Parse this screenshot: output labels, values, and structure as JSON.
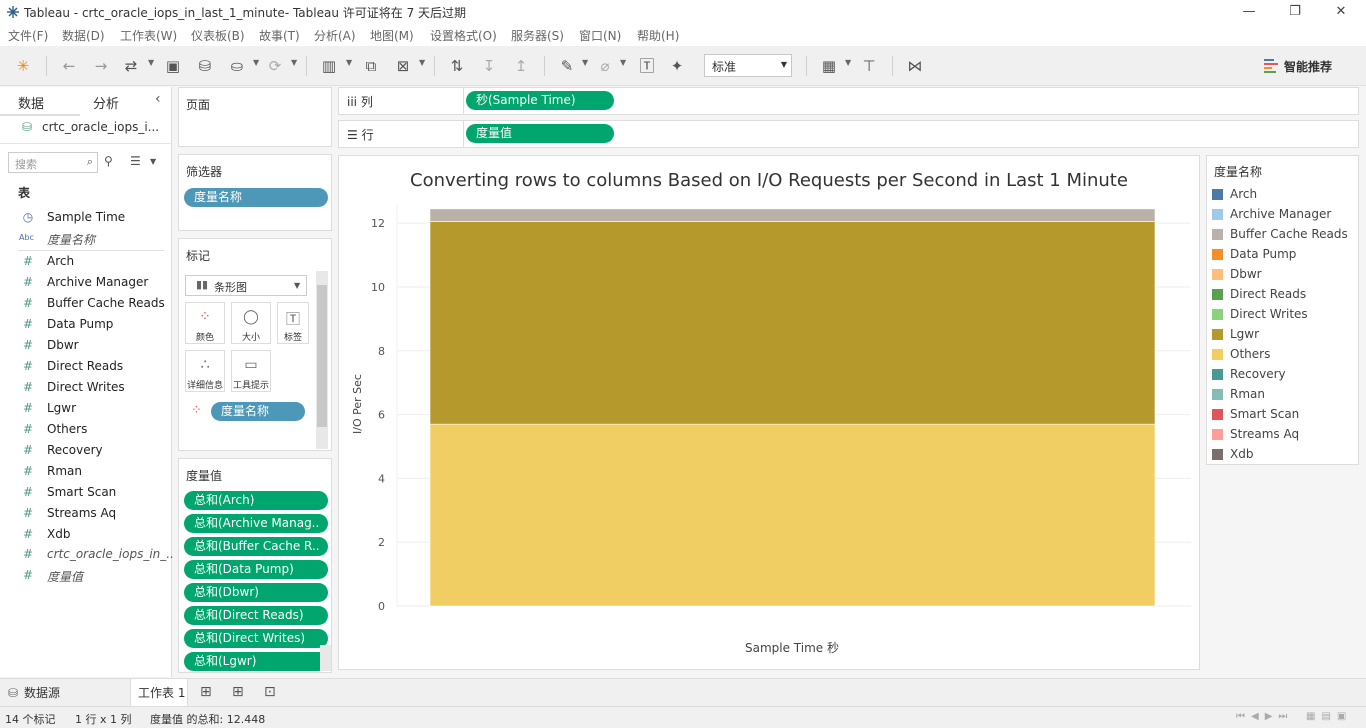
{
  "window": {
    "title": "Tableau - crtc_oracle_iops_in_last_1_minute- Tableau 许可证将在 7 天后过期"
  },
  "menu": [
    "文件(F)",
    "数据(D)",
    "工作表(W)",
    "仪表板(B)",
    "故事(T)",
    "分析(A)",
    "地图(M)",
    "设置格式(O)",
    "服务器(S)",
    "窗口(N)",
    "帮助(H)"
  ],
  "toolbar": {
    "fit_select": "标准",
    "smart_label": "智能推荐"
  },
  "data_pane": {
    "tab_data": "数据",
    "tab_analytics": "分析",
    "datasource": "crtc_oracle_iops_i...",
    "search_placeholder": "搜索",
    "tables_header": "表",
    "fields": [
      {
        "name": "Sample Time",
        "type": "datetime"
      },
      {
        "name": "度量名称",
        "type": "abc",
        "italic": true
      },
      {
        "name": "Arch",
        "type": "measure"
      },
      {
        "name": "Archive Manager",
        "type": "measure"
      },
      {
        "name": "Buffer Cache Reads",
        "type": "measure"
      },
      {
        "name": "Data Pump",
        "type": "measure"
      },
      {
        "name": "Dbwr",
        "type": "measure"
      },
      {
        "name": "Direct Reads",
        "type": "measure"
      },
      {
        "name": "Direct Writes",
        "type": "measure"
      },
      {
        "name": "Lgwr",
        "type": "measure"
      },
      {
        "name": "Others",
        "type": "measure"
      },
      {
        "name": "Recovery",
        "type": "measure"
      },
      {
        "name": "Rman",
        "type": "measure"
      },
      {
        "name": "Smart Scan",
        "type": "measure"
      },
      {
        "name": "Streams Aq",
        "type": "measure"
      },
      {
        "name": "Xdb",
        "type": "measure"
      },
      {
        "name": "crtc_oracle_iops_in_...",
        "type": "measure",
        "italic": true
      },
      {
        "name": "度量值",
        "type": "measure",
        "italic": true
      }
    ]
  },
  "pages": {
    "title": "页面"
  },
  "filters": {
    "title": "筛选器",
    "pill": "度量名称"
  },
  "marks": {
    "title": "标记",
    "type": "条形图",
    "buttons": [
      "颜色",
      "大小",
      "标签",
      "详细信息",
      "工具提示"
    ],
    "color_pill": "度量名称"
  },
  "measure_values": {
    "title": "度量值",
    "pills": [
      "总和(Arch)",
      "总和(Archive Manag..",
      "总和(Buffer Cache R..",
      "总和(Data Pump)",
      "总和(Dbwr)",
      "总和(Direct Reads)",
      "总和(Direct Writes)",
      "总和(Lgwr)"
    ]
  },
  "shelves": {
    "columns_label": "列",
    "columns_pill": "秒(Sample Time)",
    "rows_label": "行",
    "rows_pill": "度量值"
  },
  "chart_data": {
    "type": "bar",
    "stacked": true,
    "title": "Converting rows to columns Based on I/O Requests per Second in Last 1 Minute",
    "xlabel": "Sample Time 秒",
    "ylabel": "I/O Per Sec",
    "ylim": [
      0,
      12.6
    ],
    "yticks": [
      0,
      2,
      4,
      6,
      8,
      10,
      12
    ],
    "grid": true,
    "categories": [
      ""
    ],
    "series": [
      {
        "name": "Others",
        "color": "#f1ce63",
        "values": [
          5.7
        ]
      },
      {
        "name": "Lgwr",
        "color": "#b6992d",
        "values": [
          6.35
        ]
      },
      {
        "name": "Buffer Cache Reads",
        "color": "#bab0ac",
        "values": [
          0.398
        ]
      }
    ],
    "total": 12.448
  },
  "legend": {
    "title": "度量名称",
    "items": [
      {
        "name": "Arch",
        "color": "#4e79a7"
      },
      {
        "name": "Archive Manager",
        "color": "#a0cbe8"
      },
      {
        "name": "Buffer Cache Reads",
        "color": "#bab0ac"
      },
      {
        "name": "Data Pump",
        "color": "#f28e2b"
      },
      {
        "name": "Dbwr",
        "color": "#ffbe7d"
      },
      {
        "name": "Direct Reads",
        "color": "#59a14f"
      },
      {
        "name": "Direct Writes",
        "color": "#8cd17d"
      },
      {
        "name": "Lgwr",
        "color": "#b6992d"
      },
      {
        "name": "Others",
        "color": "#f1ce63"
      },
      {
        "name": "Recovery",
        "color": "#499894"
      },
      {
        "name": "Rman",
        "color": "#86bcb6"
      },
      {
        "name": "Smart Scan",
        "color": "#e15759"
      },
      {
        "name": "Streams Aq",
        "color": "#ff9d9a"
      },
      {
        "name": "Xdb",
        "color": "#79706e"
      }
    ]
  },
  "tabs": {
    "datasource": "数据源",
    "sheet1": "工作表 1"
  },
  "status": {
    "marks": "14 个标记",
    "rows_cols": "1 行 x 1 列",
    "sum": "度量值 的总和: 12.448"
  }
}
